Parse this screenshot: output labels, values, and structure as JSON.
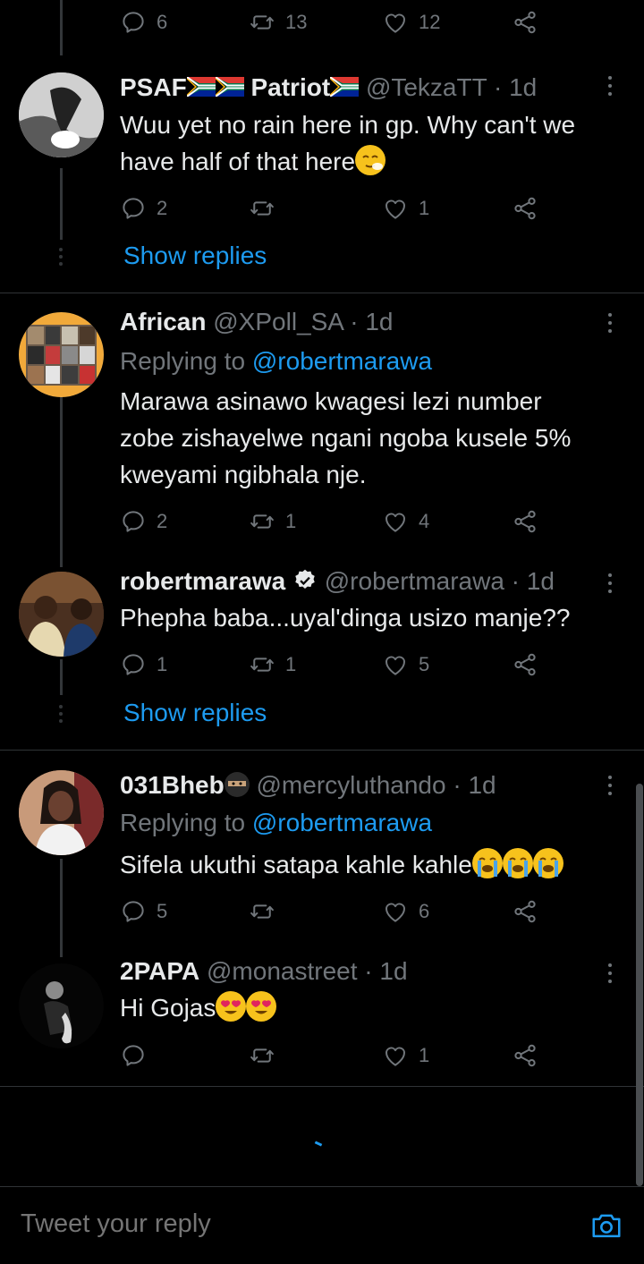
{
  "top_actions": {
    "reply": "6",
    "retweet": "13",
    "like": "12"
  },
  "tweets": [
    {
      "name": "PSAF",
      "name2": "Patriot",
      "handle": "@TekzaTT",
      "time": "1d",
      "lines": [
        "Wuu yet no rain here in gp. Why can't we",
        "have half of that here"
      ],
      "actions": {
        "reply": "2",
        "retweet": "",
        "like": "1"
      }
    },
    {
      "name": "African",
      "handle": "@XPoll_SA",
      "time": "1d",
      "replying_label": "Replying to",
      "replying_to": "@robertmarawa",
      "lines": [
        "Marawa asinawo kwagesi lezi number",
        "zobe zishayelwe ngani ngoba kusele 5%",
        "kweyami ngibhala nje."
      ],
      "actions": {
        "reply": "2",
        "retweet": "1",
        "like": "4"
      }
    },
    {
      "name": "robertmarawa",
      "handle": "@robertmarawa",
      "time": "1d",
      "lines": [
        "Phepha baba...uyal'dinga usizo manje??"
      ],
      "actions": {
        "reply": "1",
        "retweet": "1",
        "like": "5"
      }
    },
    {
      "name": "031Bheb",
      "handle": "@mercyluthando",
      "time": "1d",
      "replying_label": "Replying to",
      "replying_to": "@robertmarawa",
      "lines": [
        "Sifela ukuthi satapa kahle kahle"
      ],
      "actions": {
        "reply": "5",
        "retweet": "",
        "like": "6"
      }
    },
    {
      "name": "2PAPA",
      "handle": "@monastreet",
      "time": "1d",
      "lines": [
        "Hi Gojas"
      ],
      "actions": {
        "reply": "",
        "retweet": "",
        "like": "1"
      }
    }
  ],
  "show_replies": "Show replies",
  "reply_bar": {
    "placeholder": "Tweet your reply"
  },
  "colors": {
    "accent": "#1d9bf0",
    "muted": "#71767b",
    "background": "#000000"
  }
}
